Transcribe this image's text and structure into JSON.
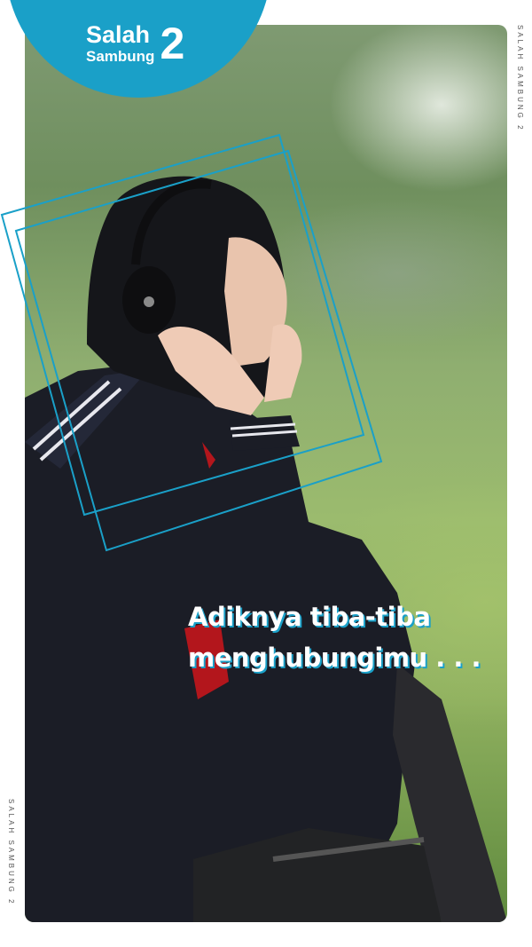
{
  "brand": {
    "word1": "Salah",
    "word2": "Sambung",
    "number": "2",
    "accent_color": "#1aa0c8"
  },
  "side_labels": {
    "top": "SALAH SAMBUNG 2",
    "bottom": "SALAH SAMBUNG 2"
  },
  "caption": {
    "line1": "Adiknya tiba-tiba",
    "line2": "menghubungimu . . ."
  },
  "photo": {
    "subject": "girl in school uniform wearing headphones sitting on grass"
  }
}
